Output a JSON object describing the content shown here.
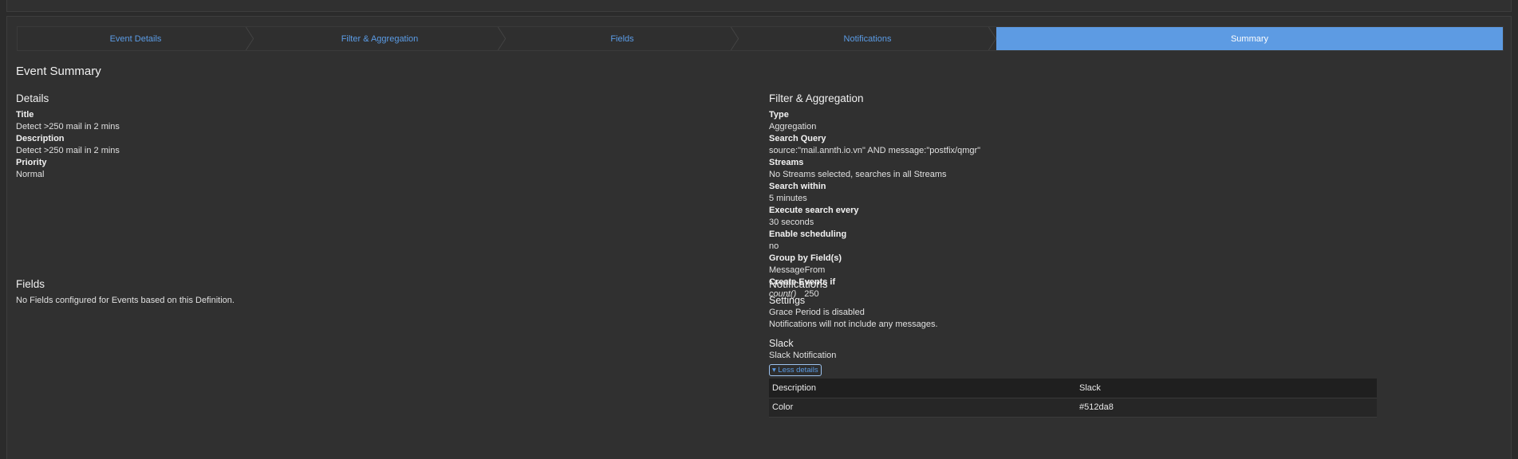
{
  "stepper": {
    "steps": [
      {
        "label": "Event Details",
        "active": false
      },
      {
        "label": "Filter & Aggregation",
        "active": false
      },
      {
        "label": "Fields",
        "active": false
      },
      {
        "label": "Notifications",
        "active": false
      },
      {
        "label": "Summary",
        "active": true
      }
    ],
    "active_color": "#5d9be3",
    "link_color": "#5b9ce6"
  },
  "summary": {
    "title": "Event Summary",
    "details": {
      "heading": "Details",
      "title_label": "Title",
      "title_value": "Detect >250 mail in 2 mins",
      "description_label": "Description",
      "description_value": "Detect >250 mail in 2 mins",
      "priority_label": "Priority",
      "priority_value": "Normal"
    },
    "filter": {
      "heading": "Filter & Aggregation",
      "type_label": "Type",
      "type_value": "Aggregation",
      "query_label": "Search Query",
      "query_value": "source:\"mail.annth.io.vn\" AND message:\"postfix/qmgr\"",
      "streams_label": "Streams",
      "streams_value": "No Streams selected, searches in all Streams",
      "within_label": "Search within",
      "within_value": "5 minutes",
      "every_label": "Execute search every",
      "every_value": "30 seconds",
      "scheduling_label": "Enable scheduling",
      "scheduling_value": "no",
      "groupby_label": "Group by Field(s)",
      "groupby_value": "MessageFrom",
      "create_label": "Create Events if",
      "create_func": "count()",
      "create_threshold": "250"
    },
    "fields": {
      "heading": "Fields",
      "empty_text": "No Fields configured for Events based on this Definition."
    },
    "notifications": {
      "heading": "Notifications",
      "settings_heading": "Settings",
      "grace_text": "Grace Period is disabled",
      "messages_text": "Notifications will not include any messages.",
      "slack_heading": "Slack",
      "slack_subtitle": "Slack Notification",
      "less_details_label": "▾ Less details",
      "table": [
        {
          "key": "Description",
          "value": "Slack"
        },
        {
          "key": "Color",
          "value": "#512da8"
        }
      ]
    }
  }
}
